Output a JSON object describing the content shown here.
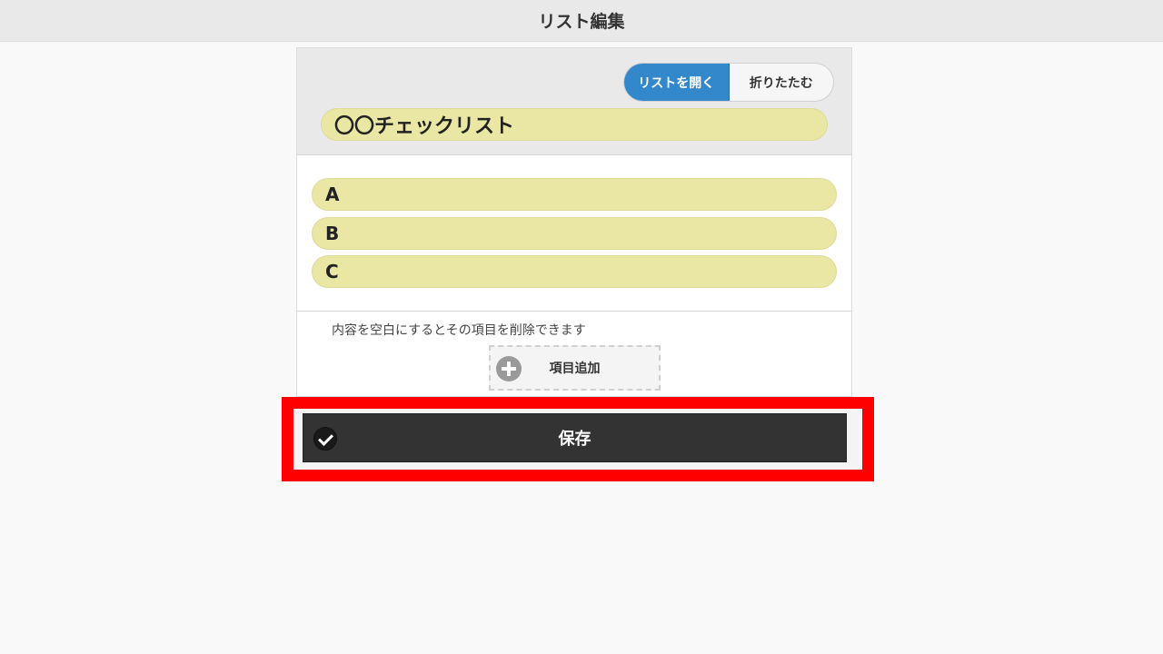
{
  "header": {
    "title": "リスト編集"
  },
  "toggle": {
    "open_label": "リストを開く",
    "collapse_label": "折りたたむ"
  },
  "list": {
    "title": "〇〇チェックリスト"
  },
  "items": [
    {
      "label": "A"
    },
    {
      "label": "B"
    },
    {
      "label": "C"
    }
  ],
  "hint": "内容を空白にするとその項目を削除できます",
  "add_button": {
    "label": "項目追加"
  },
  "save_button": {
    "label": "保存"
  },
  "colors": {
    "accent": "#3388cc",
    "pill": "#eae6a4",
    "save": "#333333",
    "highlight": "#ff0000"
  },
  "icons": {
    "add": "plus-circle-icon",
    "save": "check-circle-icon"
  }
}
